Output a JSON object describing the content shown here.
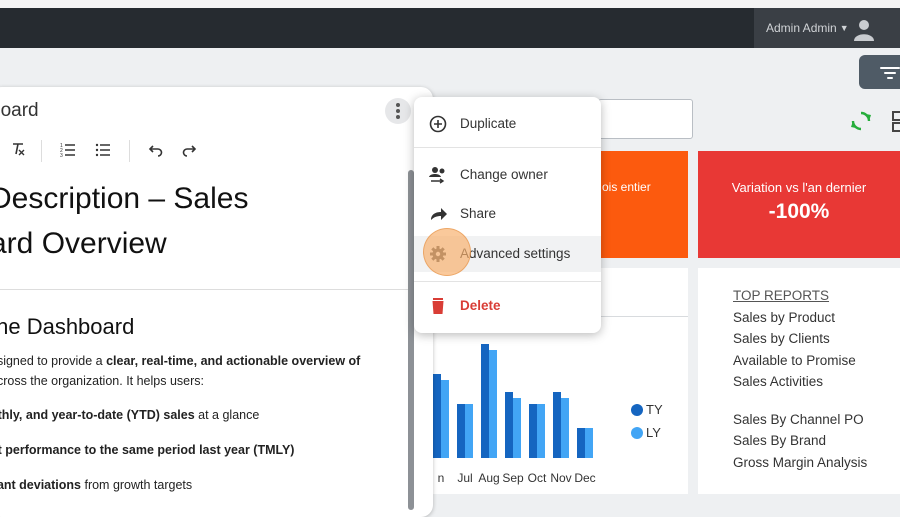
{
  "header": {
    "username": "Admin Admin"
  },
  "dashboard": {
    "kpi_orange_label": "ois entier",
    "kpi_red": {
      "label": "Variation vs l'an dernier",
      "value": "-100%"
    },
    "colors": {
      "orange": "#fc5a0e",
      "red": "#e83835",
      "ty": "#1565c0",
      "ly": "#42a5f5"
    },
    "chart_data": {
      "type": "bar",
      "categories": [
        "n",
        "Jul",
        "Aug",
        "Sep",
        "Oct",
        "Nov",
        "Dec"
      ],
      "series": [
        {
          "name": "TY",
          "values": [
            14,
            9,
            19,
            11,
            9,
            11,
            5
          ]
        },
        {
          "name": "LY",
          "values": [
            13,
            9,
            18,
            10,
            9,
            10,
            5
          ]
        }
      ],
      "legend_position": "right"
    },
    "top_reports": {
      "title": "TOP REPORTS",
      "items": [
        "Sales by Product",
        "Sales by Clients",
        "Available to Promise",
        "Sales Activities"
      ],
      "items2": [
        "Sales By Channel PO",
        "Sales By Brand",
        "Gross Margin Analysis"
      ]
    }
  },
  "editor": {
    "title": "board",
    "heading1_line1": "Description – Sales",
    "heading1_line2": "ard Overview",
    "heading2": "the Dashboard",
    "p1_a": "esigned to provide a ",
    "p1_b": "clear, real-time, and actionable overview of",
    "p1_c": "across the organization. It helps users:",
    "b1_a": "nthly, and year-to-date (YTD) sales",
    "b1_b": " at a glance",
    "b2": "nt performance to the same period last year (TMLY)",
    "b3_a": "cant deviations",
    "b3_b": " from growth targets"
  },
  "menu": {
    "items": [
      {
        "label": "Duplicate",
        "icon": "add-circle-icon"
      },
      {
        "label": "Change owner",
        "icon": "people-swap-icon"
      },
      {
        "label": "Share",
        "icon": "share-arrow-icon"
      },
      {
        "label": "Advanced settings",
        "icon": "gear-icon"
      },
      {
        "label": "Delete",
        "icon": "trash-icon"
      }
    ]
  }
}
